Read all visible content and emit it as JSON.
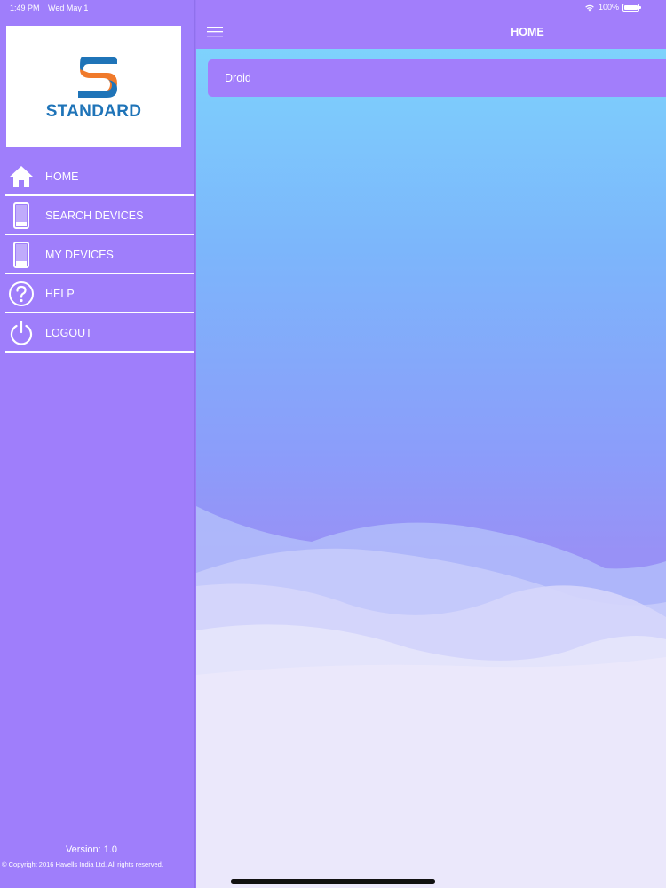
{
  "status_bar": {
    "time": "1:49 PM",
    "date": "Wed May 1",
    "battery": "100%",
    "icons": [
      "wifi-icon",
      "battery-icon"
    ]
  },
  "sidebar": {
    "logo_text": "STANDARD",
    "items": [
      {
        "label": "HOME",
        "icon": "home-icon"
      },
      {
        "label": "SEARCH DEVICES",
        "icon": "device-icon"
      },
      {
        "label": "MY DEVICES",
        "icon": "device-icon"
      },
      {
        "label": "HELP",
        "icon": "help-icon"
      },
      {
        "label": "LOGOUT",
        "icon": "power-icon"
      }
    ],
    "version": "Version: 1.0",
    "copyright": "© Copyright 2016 Havells India Ltd. All rights reserved."
  },
  "header": {
    "title": "HOME",
    "menu_icon": "hamburger-menu-icon"
  },
  "devices": [
    {
      "name": "Droid"
    }
  ],
  "colors": {
    "accent": "#a27efb",
    "sidebar_bg": "#9f7efb",
    "logo_blue": "#1f74b8",
    "logo_orange": "#f07a2b",
    "gradient_top": "#7ed9fd",
    "gradient_bottom": "#9891f6"
  }
}
